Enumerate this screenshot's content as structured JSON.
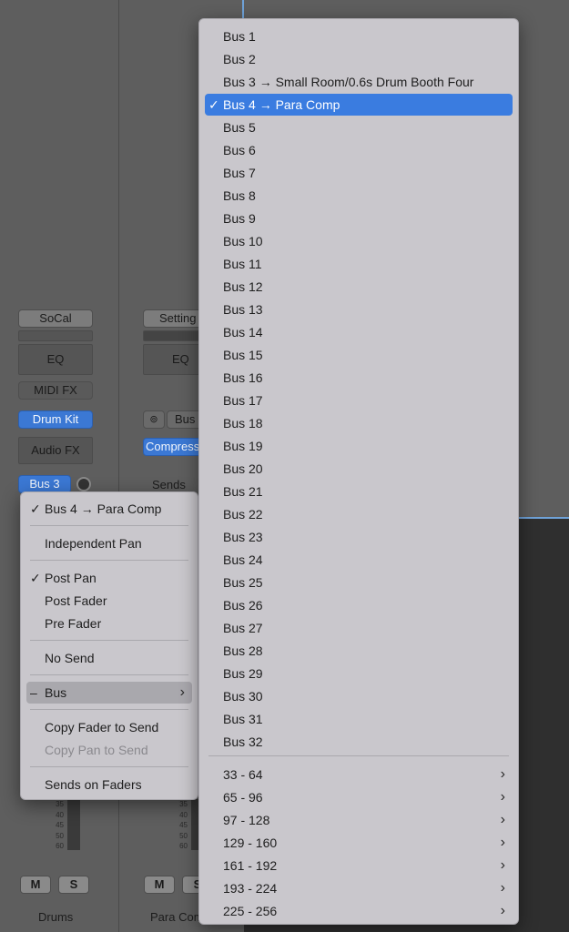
{
  "mixer": {
    "left_strip": {
      "setting_label": "SoCal",
      "eq_label": "EQ",
      "midi_fx_label": "MIDI FX",
      "instrument_label": "Drum Kit",
      "audio_fx_label": "Audio FX",
      "send_label": "Bus 3",
      "mute_label": "M",
      "solo_label": "S",
      "name": "Drums"
    },
    "right_strip": {
      "setting_label": "Setting",
      "eq_label": "EQ",
      "input_label": "Bus",
      "audio_fx_label": "Compress",
      "sends_label": "Sends",
      "mute_label": "M",
      "solo_label": "S",
      "name": "Para Comp"
    },
    "fader_scale": [
      "35",
      "40",
      "45",
      "50",
      "60"
    ]
  },
  "send_menu": {
    "items": [
      {
        "label": "Bus 4 → Para Comp",
        "checked": true
      },
      {
        "label": "Independent Pan"
      },
      {
        "label": "Post Pan",
        "checked": true
      },
      {
        "label": "Post Fader"
      },
      {
        "label": "Pre Fader"
      },
      {
        "label": "No Send"
      },
      {
        "label": "Bus",
        "dash": true,
        "submenu": true
      },
      {
        "label": "Copy Fader to Send"
      },
      {
        "label": "Copy Pan to Send",
        "disabled": true
      },
      {
        "label": "Sends on Faders"
      }
    ]
  },
  "bus_menu": {
    "buses": [
      "Bus 1",
      "Bus 2",
      "Bus 3 → Small Room/0.6s Drum Booth Four",
      "Bus 4 → Para Comp",
      "Bus 5",
      "Bus 6",
      "Bus 7",
      "Bus 8",
      "Bus 9",
      "Bus 10",
      "Bus 11",
      "Bus 12",
      "Bus 13",
      "Bus 14",
      "Bus 15",
      "Bus 16",
      "Bus 17",
      "Bus 18",
      "Bus 19",
      "Bus 20",
      "Bus 21",
      "Bus 22",
      "Bus 23",
      "Bus 24",
      "Bus 25",
      "Bus 26",
      "Bus 27",
      "Bus 28",
      "Bus 29",
      "Bus 30",
      "Bus 31",
      "Bus 32"
    ],
    "selected_index": 3,
    "ranges": [
      "33 - 64",
      "65 - 96",
      "97 - 128",
      "129 - 160",
      "161 - 192",
      "193 - 224",
      "225 - 256"
    ]
  },
  "colors": {
    "selection": "#3a7ce0",
    "menu_bg": "#c9c7cc",
    "mixer_bg": "#5e5e5e"
  }
}
